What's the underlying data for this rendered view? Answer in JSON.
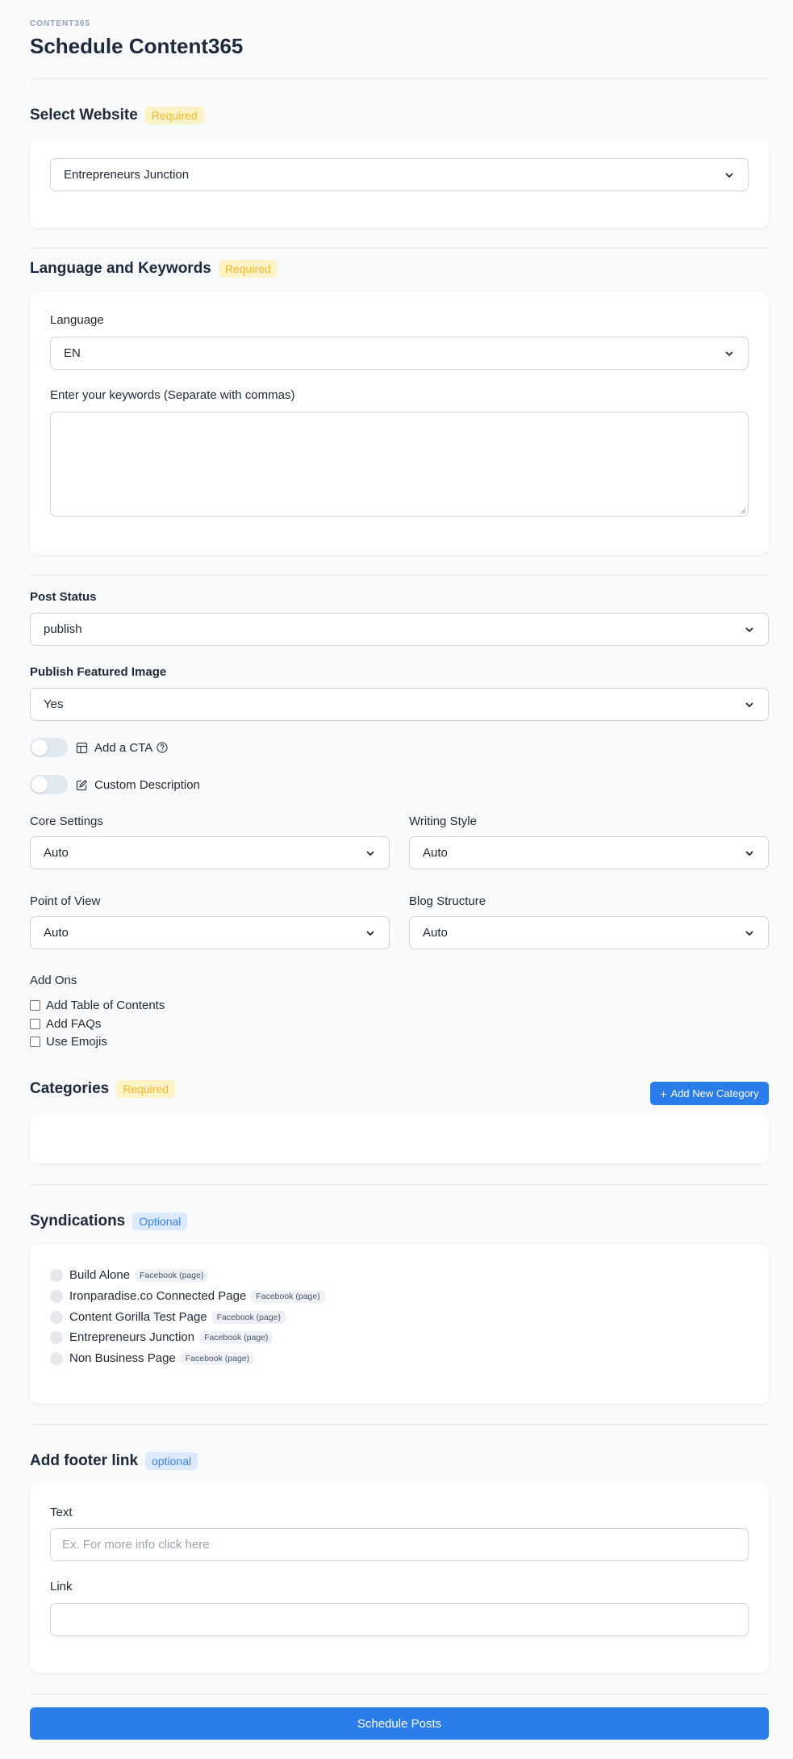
{
  "header": {
    "eyebrow": "CONTENT365",
    "title": "Schedule Content365"
  },
  "website": {
    "title": "Select Website",
    "badge": "Required",
    "selected": "Entrepreneurs Junction"
  },
  "language_keywords": {
    "title": "Language and Keywords",
    "badge": "Required",
    "language_label": "Language",
    "language_value": "EN",
    "keywords_label": "Enter your keywords (Separate with commas)",
    "keywords_value": ""
  },
  "post_status": {
    "label": "Post Status",
    "value": "publish"
  },
  "featured_image": {
    "label": "Publish Featured Image",
    "value": "Yes"
  },
  "toggles": {
    "cta_label": "Add a CTA",
    "custom_desc_label": "Custom Description"
  },
  "settings": {
    "core_label": "Core Settings",
    "core_value": "Auto",
    "style_label": "Writing Style",
    "style_value": "Auto",
    "pov_label": "Point of View",
    "pov_value": "Auto",
    "structure_label": "Blog Structure",
    "structure_value": "Auto"
  },
  "addons": {
    "label": "Add Ons",
    "items": [
      "Add Table of Contents",
      "Add FAQs",
      "Use Emojis"
    ]
  },
  "categories": {
    "title": "Categories",
    "badge": "Required",
    "add_button": "Add New Category"
  },
  "syndications": {
    "title": "Syndications",
    "badge": "Optional",
    "items": [
      {
        "name": "Build Alone",
        "type": "Facebook (page)"
      },
      {
        "name": "Ironparadise.co Connected Page",
        "type": "Facebook (page)"
      },
      {
        "name": "Content Gorilla Test Page",
        "type": "Facebook (page)"
      },
      {
        "name": "Entrepreneurs Junction",
        "type": "Facebook (page)"
      },
      {
        "name": "Non Business Page",
        "type": "Facebook (page)"
      }
    ]
  },
  "footer_link": {
    "title": "Add footer link",
    "badge": "optional",
    "text_label": "Text",
    "text_placeholder": "Ex. For more info click here",
    "link_label": "Link",
    "link_value": ""
  },
  "submit": {
    "label": "Schedule Posts"
  },
  "colors": {
    "primary": "#2b7de9",
    "required_bg": "#fef3c7",
    "required_fg": "#f5b72a",
    "optional_bg": "#dbeafe",
    "optional_fg": "#3b82f6"
  }
}
